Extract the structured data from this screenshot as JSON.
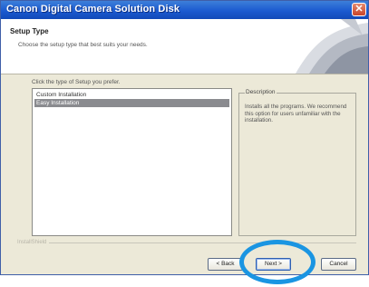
{
  "window": {
    "title": "Canon Digital Camera Solution Disk",
    "close_glyph": "✕"
  },
  "header": {
    "title": "Setup Type",
    "subtitle": "Choose the setup type that best suits your needs."
  },
  "prompt": "Click the type of Setup you prefer.",
  "setup_types": {
    "items": [
      {
        "label": "Custom Installation",
        "selected": false
      },
      {
        "label": "Easy Installation",
        "selected": true
      }
    ]
  },
  "description": {
    "legend": "Description",
    "text": "Installs all the programs. We recommend this option for users unfamiliar with the installation."
  },
  "footer": {
    "installshield_label": "InstallShield"
  },
  "buttons": {
    "back": "< Back",
    "next": "Next >",
    "cancel": "Cancel"
  },
  "colors": {
    "titlebar": "#1b5ad0",
    "selection": "#8a8b8f",
    "highlight_ring": "#1a95e2",
    "dialog_bg": "#ece9d8"
  }
}
